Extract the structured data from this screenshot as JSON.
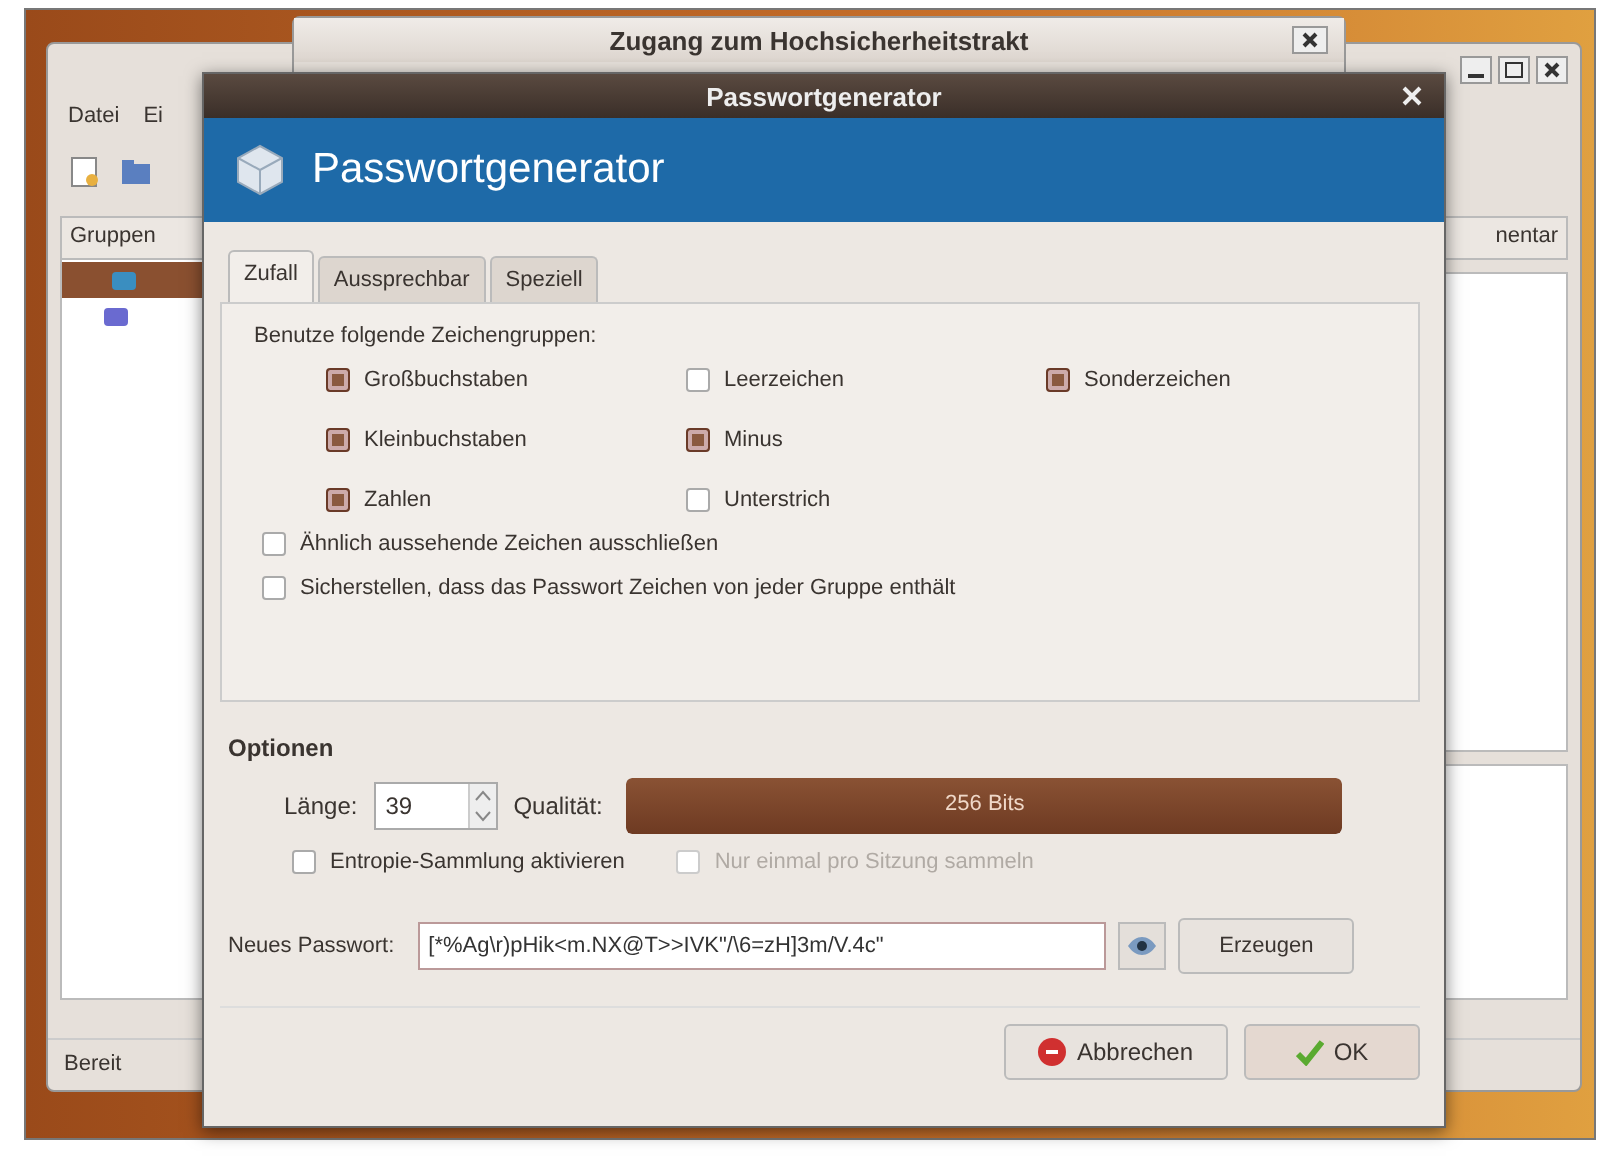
{
  "back_window": {
    "menu": [
      "Datei",
      "Ei"
    ],
    "groups_header": "Gruppen",
    "column_header": "nentar",
    "tree_rows": [
      {
        "selected": true
      },
      {
        "selected": false
      }
    ],
    "status_bar": "Bereit"
  },
  "middle_window": {
    "title": "Zugang zum Hochsicherheitstrakt"
  },
  "dialog": {
    "title": "Passwortgenerator",
    "banner": "Passwortgenerator",
    "tabs": [
      {
        "label": "Zufall",
        "selected": true
      },
      {
        "label": "Aussprechbar",
        "selected": false
      },
      {
        "label": "Speziell",
        "selected": false
      }
    ],
    "groups_label": "Benutze folgende Zeichengruppen:",
    "char_groups": [
      {
        "label": "Großbuchstaben",
        "checked": true
      },
      {
        "label": "Kleinbuchstaben",
        "checked": true
      },
      {
        "label": "Zahlen",
        "checked": true
      },
      {
        "label": "Leerzeichen",
        "checked": false
      },
      {
        "label": "Minus",
        "checked": true
      },
      {
        "label": "Unterstrich",
        "checked": false
      },
      {
        "label": "Sonderzeichen",
        "checked": true
      }
    ],
    "rules": [
      {
        "label": "Ähnlich aussehende Zeichen ausschließen",
        "checked": false
      },
      {
        "label": "Sicherstellen, dass das Passwort Zeichen von jeder Gruppe enthält",
        "checked": false
      }
    ],
    "options_heading": "Optionen",
    "length_label": "Länge:",
    "length": "39",
    "quality_label": "Qualität:",
    "quality": {
      "level": 1,
      "text": "256 Bits"
    },
    "entropy": {
      "label": "Entropie-Sammlung aktivieren",
      "checked": false,
      "disabled": false
    },
    "session": {
      "label": "Nur einmal pro Sitzung sammeln",
      "checked": false,
      "disabled": true
    },
    "password_label": "Neues Passwort:",
    "password": "[*%Ag\\r)pHik<m.NX@T>>IVK\"/\\6=zH]3m/V.4c\"",
    "generate": "Erzeugen",
    "buttons": [
      {
        "kind": "cancel",
        "label": "Abbrechen"
      },
      {
        "kind": "ok",
        "label": "OK"
      }
    ]
  }
}
